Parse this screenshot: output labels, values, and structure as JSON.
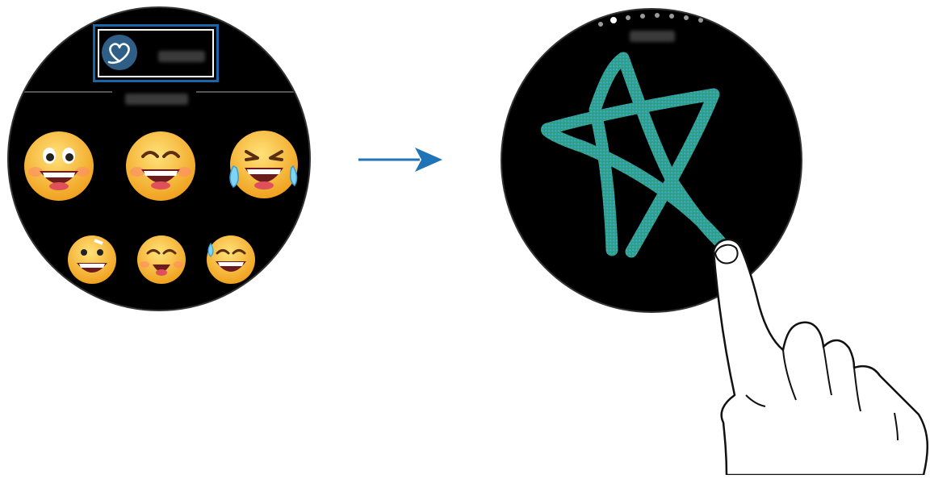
{
  "left_screen": {
    "sticker_tab": {
      "icon": "heart-outline-icon",
      "label": "",
      "selected": true
    },
    "section_label": "",
    "emojis_row1": [
      {
        "icon": "grinning-wide-eyes-emoji"
      },
      {
        "icon": "grinning-squinting-emoji"
      },
      {
        "icon": "laughing-tears-emoji"
      }
    ],
    "emojis_row2": [
      {
        "icon": "grinning-bandaged-emoji"
      },
      {
        "icon": "winking-laughing-emoji"
      },
      {
        "icon": "grinning-sweat-emoji"
      }
    ]
  },
  "transition_arrow": {
    "icon": "arrow-right-icon",
    "color": "#1f74b8"
  },
  "right_screen": {
    "page_indicator": {
      "count": 8,
      "active_index": 1
    },
    "title": "",
    "drawing": {
      "shape": "star",
      "color_start": "#2e9e58",
      "color_end": "#2aa5c9"
    },
    "finger": {
      "icon": "hand-pointer-icon"
    }
  },
  "colors": {
    "highlight_border": "#1a66a8",
    "screen_bg": "#000000"
  }
}
